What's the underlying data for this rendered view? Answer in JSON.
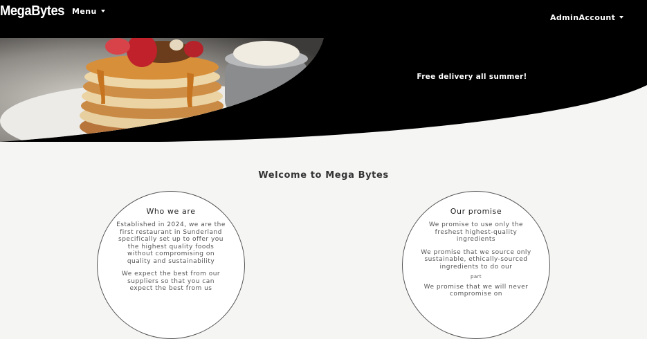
{
  "navbar": {
    "brand": "MegaBytes",
    "menu_label": "Menu",
    "account_label": "AdminAccount"
  },
  "hero": {
    "promo_text": "Free delivery all summer!"
  },
  "main": {
    "welcome": "Welcome to Mega Bytes",
    "who": {
      "title": "Who we are",
      "p1": "Established in 2024, we are the first restaurant in Sunderland specifically set up to offer you the highest quality foods without compromising on quality and sustainability",
      "p2": "We expect the best from our suppliers so that you can expect the best from us"
    },
    "promise": {
      "title": "Our promise",
      "p1": "We promise to use only the freshest highest-quality ingredients",
      "p2": "We promise that we source only sustainable, ethically-sourced ingredients to do our",
      "p2_small": "part",
      "p3": "We promise that we will never compromise on"
    }
  }
}
